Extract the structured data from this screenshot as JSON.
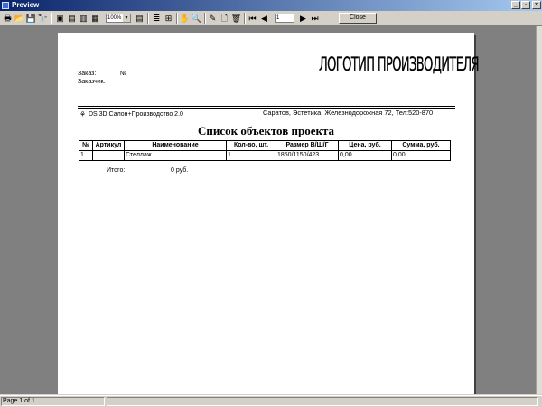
{
  "window": {
    "title": "Preview"
  },
  "toolbar": {
    "zoom": "100%",
    "page_number": "1",
    "close_label": "Close"
  },
  "report": {
    "order_label": "Заказ:",
    "number_label": "№",
    "customer_label": "Заказчик:",
    "logo_text": "ЛОГОТИП ПРОИЗВОДИТЕЛЯ",
    "program_name": "DS 3D Салон+Производство 2.0",
    "company_address": "Саратов, Эстетика, Железнодорожная 72, Тел:520-870",
    "title": "Список объектов проекта",
    "columns": [
      "№",
      "Артикул",
      "Наименование",
      "Кол-во, шт.",
      "Размер В/Ш/Г",
      "Цена, руб.",
      "Сумма, руб."
    ],
    "rows": [
      [
        "1",
        "",
        "Стеллаж",
        "1",
        "1850/1150/423",
        "0,00",
        "0,00"
      ]
    ],
    "total_label": "Итого:",
    "total_value": "0 руб."
  },
  "status": {
    "page_info": "Page 1 of 1"
  }
}
